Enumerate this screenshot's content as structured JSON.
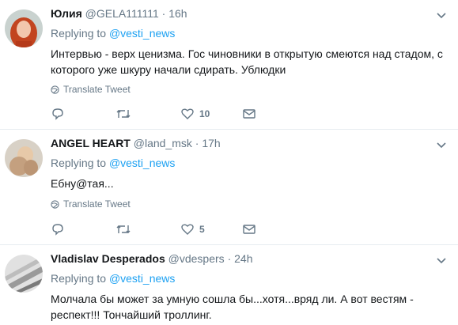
{
  "tweets": [
    {
      "name": "Юлия",
      "handle": "@GELA111111",
      "time": "16h",
      "replying_prefix": "Replying to",
      "replying_to": "@vesti_news",
      "text": "Интервью - верх ценизма. Гос чиновники в открытую смеются над стадом, с которого уже шкуру начали сдирать. Ублюдки",
      "translate": "Translate Tweet",
      "likes": "10"
    },
    {
      "name": "ANGEL HEART",
      "handle": "@land_msk",
      "time": "17h",
      "replying_prefix": "Replying to",
      "replying_to": "@vesti_news",
      "text": "Ебну@тая...",
      "translate": "Translate Tweet",
      "likes": "5"
    },
    {
      "name": "Vladislav Desperados",
      "handle": "@vdespers",
      "time": "24h",
      "replying_prefix": "Replying to",
      "replying_to": "@vesti_news",
      "text": "Молчала бы может за умную сошла бы...хотя...вряд ли. А вот вестям - респект!!! Тончайший троллинг."
    }
  ],
  "icons": {
    "reply": "reply-icon",
    "retweet": "retweet-icon",
    "like": "heart-icon",
    "dm": "envelope-icon",
    "globe": "globe-icon",
    "more": "chevron-down-icon"
  },
  "colors": {
    "link": "#1da1f2",
    "secondary": "#657786",
    "text": "#14171a",
    "divider": "#e6ecf0"
  }
}
